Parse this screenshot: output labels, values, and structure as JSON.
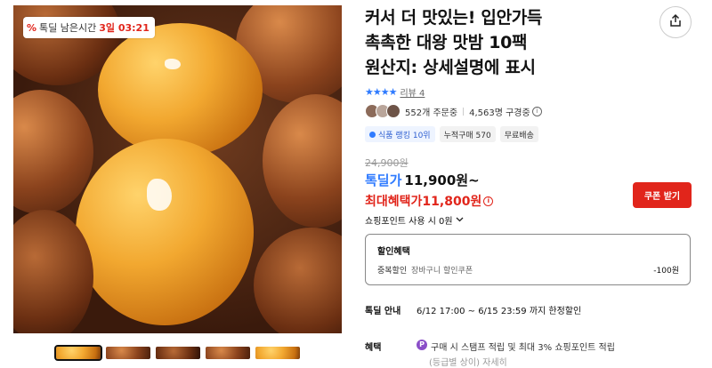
{
  "product": {
    "title_lines": [
      "커서 더 맛있는! 입안가득",
      "촉촉한 대왕 맛밤 10팩",
      "원산지: 상세설명에 표시"
    ],
    "review_label": "리뷰 4",
    "rating_stars": 4,
    "orders": "552개 주문중",
    "subscribers": "4,563명 구경중",
    "chips": [
      "식품 랭킹 10위",
      "누적구매 570",
      "무료배송"
    ]
  },
  "timer": {
    "percent_icon": "%",
    "label": "톡딜 남은시간",
    "time": "3일 03:21"
  },
  "price": {
    "original": "24,900원",
    "deal_label": "톡딜가",
    "deal_value": "11,900원~",
    "max_label": "최대혜택가",
    "max_value": "11,800원",
    "coupon_button": "쿠폰 받기",
    "points_text": "쇼핑포인트 사용 시",
    "points_value": "0원"
  },
  "discount": {
    "header": "할인혜택",
    "row_label": "중복할인",
    "row_sub": "장바구니 할인쿠폰",
    "row_amount": "-100원"
  },
  "deal_info": {
    "label": "톡딜 안내",
    "value": "6/12 17:00 ~ 6/15 23:59 까지 한정할인"
  },
  "benefit": {
    "label": "혜택",
    "badge": "P",
    "text": "구매 시 스탬프 적립 및 최대 3% 쇼핑포인트 적립",
    "extra": "(등급별 상이) 자세히"
  },
  "colors": {
    "accent_red": "#e1251b",
    "accent_blue": "#2f7bff"
  },
  "icons": {
    "share": "share-icon",
    "info": "info-icon",
    "chevron": "chevron-down-icon"
  }
}
